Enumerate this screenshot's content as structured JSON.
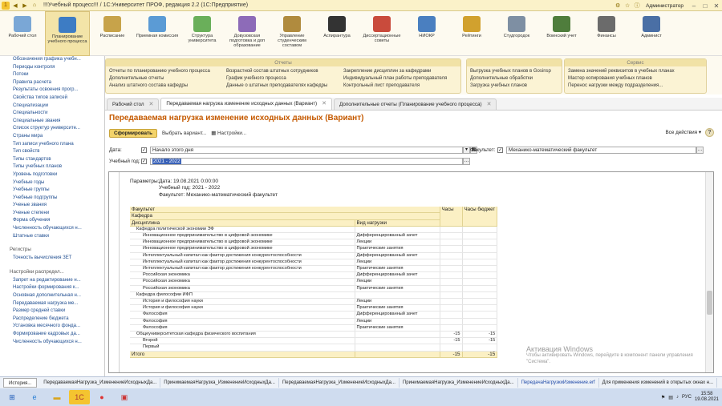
{
  "window": {
    "title": "!!!Учебный процесс!!! / 1С:Университет ПРОФ, редакция 2.2  (1С:Предприятие)",
    "user": "Администратор"
  },
  "sections": [
    {
      "label": "Рабочий стол",
      "color": "#7aa7d6"
    },
    {
      "label": "Планирование учебного процесса",
      "color": "#3d7cc4"
    },
    {
      "label": "Расписание",
      "color": "#c7a34a"
    },
    {
      "label": "Приемная комиссия",
      "color": "#5b9bd5"
    },
    {
      "label": "Структура университета",
      "color": "#6aaf5a"
    },
    {
      "label": "Довузовская подготовка и доп образование",
      "color": "#8d6bb8"
    },
    {
      "label": "Управление студенческим составом",
      "color": "#b08b3e"
    },
    {
      "label": "Аспирантура",
      "color": "#333333"
    },
    {
      "label": "Диссертационные советы",
      "color": "#c94b3c"
    },
    {
      "label": "НИОКР",
      "color": "#4a7fc0"
    },
    {
      "label": "Рейтинги",
      "color": "#d1a12e"
    },
    {
      "label": "Студгородок",
      "color": "#7e8fa3"
    },
    {
      "label": "Воинский учет",
      "color": "#4f7d3c"
    },
    {
      "label": "Финансы",
      "color": "#6b6b6b"
    },
    {
      "label": "Админист",
      "color": "#4a6fa5"
    }
  ],
  "sidebar": {
    "items": [
      "Обозначения графика учебн...",
      "Периоды контроля",
      "Потоки",
      "Правила расчета",
      "Результаты освоения прогр...",
      "Свойства типов записей",
      "Специализации",
      "Специальности",
      "Специальные звания",
      "Список структур университе...",
      "Страны мира",
      "Тип записи учебного плана",
      "Тип свойств",
      "Типы стандартов",
      "Типы учебных планов",
      "Уровень подготовки",
      "Учебные годы",
      "Учебные группы",
      "Учебные подгруппы",
      "Ученые звания",
      "Ученые степени",
      "Форма обучения",
      "Численность обучающихся н...",
      "Штатные ставки"
    ],
    "registers_label": "Регистры",
    "registers": [
      "Точность вычисления ЗЕТ"
    ],
    "settings_label": "Настройки распредел...",
    "settings": [
      "Запрет на редактирование н...",
      "Настройки формирования к...",
      "Основная дополнительная н...",
      "Передаваемая нагрузка ме...",
      "Размер средней ставки",
      "Распределение бюджета",
      "Установка месячного фонда...",
      "Формирование кадровых да...",
      "Численность обучающихся н..."
    ]
  },
  "functions": {
    "reports_title": "Отчеты",
    "reports_col1": [
      "Отчеты по планированию учебного процесса",
      "Дополнительные отчеты",
      "Анализ штатного состава кафедры"
    ],
    "reports_col2": [
      "Возрастной состав штатных сотрудников",
      "График учебного процесса",
      "Данные о штатных преподавателях кафедры"
    ],
    "reports_col3": [
      "Закрепление дисциплин за кафедрами",
      "Индивидуальный план работы преподавателя",
      "Контрольный лист преподавателя"
    ],
    "reports_col4": [
      "Выгрузка учебных планов в Gosinsp",
      "Дополнительные обработки",
      "Загрузка учебных планов"
    ],
    "service_title": "Сервис",
    "service_col": [
      "Замена значений реквизитов в учебных планах",
      "Мастер копирования учебных планов",
      "Перенос нагрузки между подразделения..."
    ]
  },
  "tabs": [
    {
      "label": "Рабочий стол"
    },
    {
      "label": "Передаваемая нагрузка изменение исходных данных (Вариант)"
    },
    {
      "label": "Дополнительные отчеты (Планирование учебного процесса)"
    }
  ],
  "document": {
    "title": "Передаваемая нагрузка изменение исходных данных (Вариант)",
    "btn_generate": "Сформировать",
    "btn_variant": "Выбрать вариант...",
    "btn_settings": "Настройки...",
    "all_actions": "Все действия ▾",
    "date_label": "Дата:",
    "date_value": "Начало этого дня",
    "faculty_label": "Факультет:",
    "faculty_value": "Механико-математический факультет",
    "year_label": "Учебный год:",
    "year_value": "2021 - 2022"
  },
  "report": {
    "params_label": "Параметры:",
    "params": [
      "Дата: 19.08.2021 0:00:00",
      "Учебный год: 2021 - 2022",
      "Факультет: Механико-математический факультет"
    ],
    "head": {
      "faculty": "Факультет",
      "dept": "Кафедра",
      "disc": "Дисциплина",
      "kind": "Вид нагрузки",
      "hours": "Часы",
      "budget": "Часы бюджет"
    },
    "rows": [
      {
        "d": "Кафедра политической экономии ЭФ",
        "k": "",
        "h": "",
        "b": "",
        "lvl": 1
      },
      {
        "d": "Инновационное предпринимательство в цифровой экономике",
        "k": "Дифференцированный зачет",
        "h": "",
        "b": "",
        "lvl": 2
      },
      {
        "d": "Инновационное предпринимательство в цифровой экономике",
        "k": "Лекции",
        "h": "",
        "b": "",
        "lvl": 2
      },
      {
        "d": "Инновационное предпринимательство в цифровой экономике",
        "k": "Практические занятия",
        "h": "",
        "b": "",
        "lvl": 2
      },
      {
        "d": "Интеллектуальный капитал как фактор достижения конкурентоспособности",
        "k": "Дифференцированный зачет",
        "h": "",
        "b": "",
        "lvl": 2
      },
      {
        "d": "Интеллектуальный капитал как фактор достижения конкурентоспособности",
        "k": "Лекции",
        "h": "",
        "b": "",
        "lvl": 2
      },
      {
        "d": "Интеллектуальный капитал как фактор достижения конкурентоспособности",
        "k": "Практические занятия",
        "h": "",
        "b": "",
        "lvl": 2
      },
      {
        "d": "Российская экономика",
        "k": "Дифференцированный зачет",
        "h": "",
        "b": "",
        "lvl": 2
      },
      {
        "d": "Российская экономика",
        "k": "Лекции",
        "h": "",
        "b": "",
        "lvl": 2
      },
      {
        "d": "Российская экономика",
        "k": "Практические занятия",
        "h": "",
        "b": "",
        "lvl": 2
      },
      {
        "d": "Кафедра философии ИФП",
        "k": "",
        "h": "",
        "b": "",
        "lvl": 1
      },
      {
        "d": "История и философия науки",
        "k": "Лекции",
        "h": "",
        "b": "",
        "lvl": 2
      },
      {
        "d": "История и философия науки",
        "k": "Практические занятия",
        "h": "",
        "b": "",
        "lvl": 2
      },
      {
        "d": "Философия",
        "k": "Дифференцированный зачет",
        "h": "",
        "b": "",
        "lvl": 2
      },
      {
        "d": "Философия",
        "k": "Лекции",
        "h": "",
        "b": "",
        "lvl": 2
      },
      {
        "d": "Философия",
        "k": "Практические занятия",
        "h": "",
        "b": "",
        "lvl": 2
      },
      {
        "d": "Общеуниверситетская кафедра физического воспитания",
        "k": "",
        "h": "-15",
        "b": "-15",
        "lvl": 1
      },
      {
        "d": "Второй",
        "k": "",
        "h": "-15",
        "b": "-15",
        "lvl": 2
      },
      {
        "d": "Первый",
        "k": "",
        "h": "",
        "b": "",
        "lvl": 2
      },
      {
        "d": "Итого",
        "k": "",
        "h": "-15",
        "b": "-15",
        "lvl": 0
      }
    ]
  },
  "taskbar": {
    "history": "История...",
    "open": [
      "ПередаваемаяНагрузка_ИзменениеИсходныхДа...",
      "ПринимаемаяНагрузка_ИзменениеИсходныхДа...",
      "ПередаваемаяНагрузка_ИзменениеИсходныхДа...",
      "ПринимаемаяНагрузка_ИзменениеИсходныхДа...",
      "ПередачаНагрузкиИзменение.erf",
      "Для применения изменений в открытых окнах н..."
    ],
    "lang": "РУС",
    "time": "15:58",
    "date": "19.08.2021"
  },
  "watermark": {
    "line1": "Активация Windows",
    "line2": "Чтобы активировать Windows, перейдите в компонент панели управления \"Система\"."
  }
}
